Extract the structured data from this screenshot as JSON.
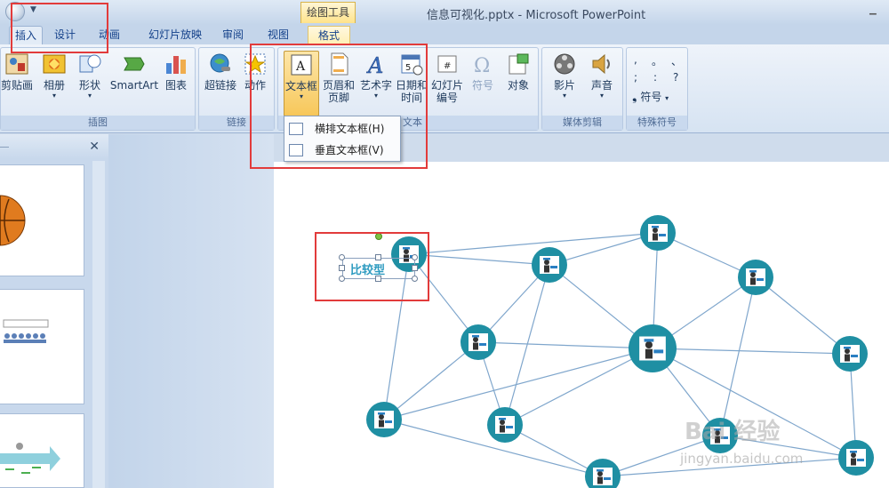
{
  "window": {
    "title": "信息可视化.pptx - Microsoft PowerPoint",
    "context_tab": "绘图工具"
  },
  "tabs": [
    {
      "label": "插入",
      "active": true
    },
    {
      "label": "设计"
    },
    {
      "label": "动画"
    },
    {
      "label": "幻灯片放映"
    },
    {
      "label": "审阅"
    },
    {
      "label": "视图"
    },
    {
      "label": "格式",
      "contextual": true
    }
  ],
  "ribbon": {
    "groups": {
      "illustrations": "插图",
      "links": "链接",
      "text": "文本",
      "media": "媒体剪辑",
      "symbols": "特殊符号"
    },
    "buttons": {
      "clipart": "剪贴画",
      "album": "相册",
      "shapes": "形状",
      "smartart": "SmartArt",
      "chart": "图表",
      "hyperlink": "超链接",
      "action": "动作",
      "textbox": "文本框",
      "header_footer_1": "页眉和",
      "header_footer_2": "页脚",
      "wordart": "艺术字",
      "datetime_1": "日期和",
      "datetime_2": "时间",
      "slide_number_1": "幻灯片",
      "slide_number_2": "编号",
      "symbol": "符号",
      "object": "对象",
      "movie": "影片",
      "sound": "声音",
      "special_symbol": "符号"
    },
    "symbols_grid": [
      ",",
      "。",
      "、",
      ";",
      ":",
      "?"
    ]
  },
  "textbox_menu": {
    "items": [
      {
        "label": "横排文本框(H)"
      },
      {
        "label": "垂直文本框(V)"
      }
    ]
  },
  "slide": {
    "textbox_text": "比较型"
  },
  "watermark": {
    "line1": "Bai 经验",
    "line2": "jingyan.baidu.com"
  },
  "colors": {
    "node": "#1f8fa3",
    "edge": "#7fa6cc",
    "annotation": "#e23b3b"
  }
}
